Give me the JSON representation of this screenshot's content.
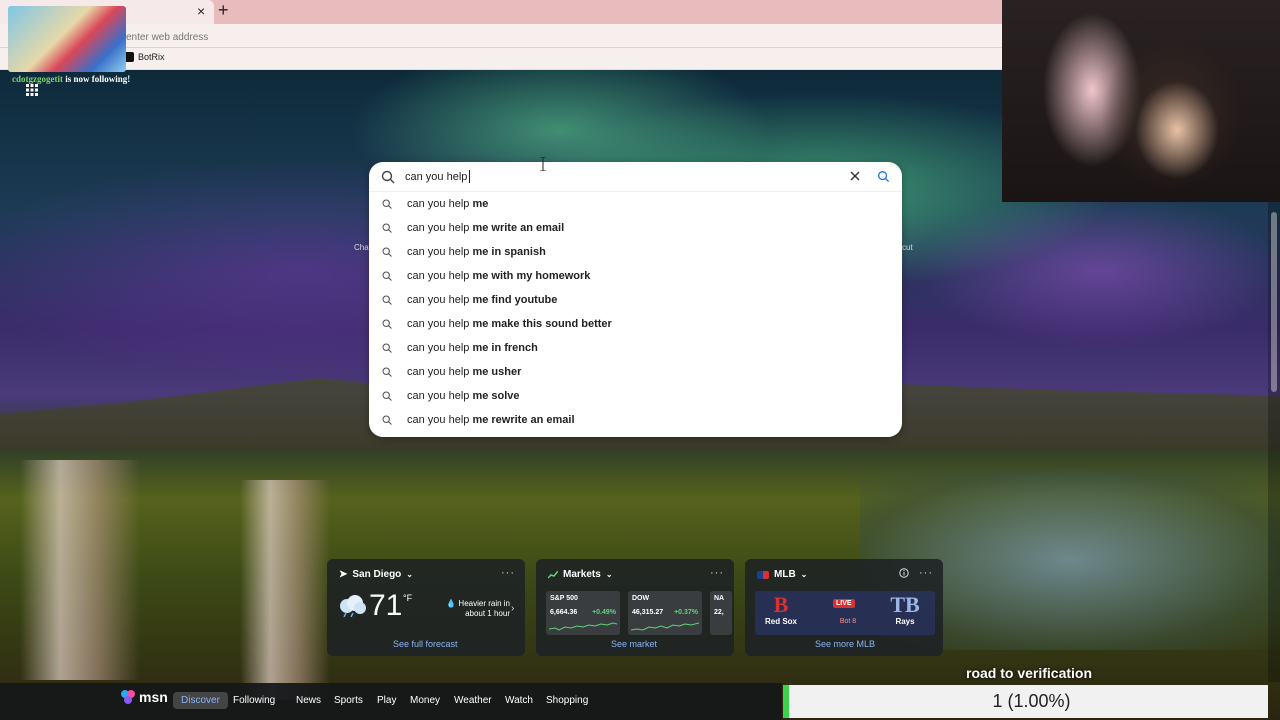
{
  "browser": {
    "address_placeholder": "enter web address",
    "tab_close": "×",
    "new_tab": "+",
    "bookmark_label": "BotRix"
  },
  "overlay": {
    "follow_username": "cdotgzgogetit",
    "follow_text": " is now following!",
    "road_text": "road to verification",
    "goal_text": "1 (1.00%)",
    "goal_progress": 1.0
  },
  "search": {
    "query": "can you help ",
    "suggestions": [
      {
        "prefix": "can you help ",
        "bold": "me"
      },
      {
        "prefix": "can you help ",
        "bold": "me write an email"
      },
      {
        "prefix": "can you help ",
        "bold": "me in spanish"
      },
      {
        "prefix": "can you help ",
        "bold": "me with my homework"
      },
      {
        "prefix": "can you help ",
        "bold": "me find youtube"
      },
      {
        "prefix": "can you help ",
        "bold": "me make this sound better"
      },
      {
        "prefix": "can you help ",
        "bold": "me in french"
      },
      {
        "prefix": "can you help ",
        "bold": "me usher"
      },
      {
        "prefix": "can you help ",
        "bold": "me solve"
      },
      {
        "prefix": "can you help ",
        "bold": "me rewrite an email"
      }
    ]
  },
  "side_labels": {
    "left": "Cha",
    "right": "cut"
  },
  "weather": {
    "location": "San Diego",
    "temp": "71",
    "unit": "°F",
    "description": "Heavier rain in about 1 hour",
    "link": "See full forecast",
    "more": "···"
  },
  "markets": {
    "title": "Markets",
    "more": "···",
    "stocks": [
      {
        "name": "S&P 500",
        "value": "6,664.36",
        "change": "+0.49%"
      },
      {
        "name": "DOW",
        "value": "46,315.27",
        "change": "+0.37%"
      },
      {
        "name": "NA",
        "value": "22,",
        "change": ""
      }
    ],
    "link": "See market"
  },
  "mlb": {
    "title": "MLB",
    "more": "···",
    "home": "Red Sox",
    "away": "Rays",
    "status": "LIVE",
    "inning": "Bot 8",
    "link": "See more MLB"
  },
  "msn": {
    "logo": "msn",
    "nav": [
      "Discover",
      "Following",
      "News",
      "Sports",
      "Play",
      "Money",
      "Weather",
      "Watch",
      "Shopping"
    ]
  },
  "colors": {
    "accent": "#8ab4f8",
    "live": "#d93030",
    "positive": "#5fd37a",
    "goal_bar": "#3bd34a"
  }
}
